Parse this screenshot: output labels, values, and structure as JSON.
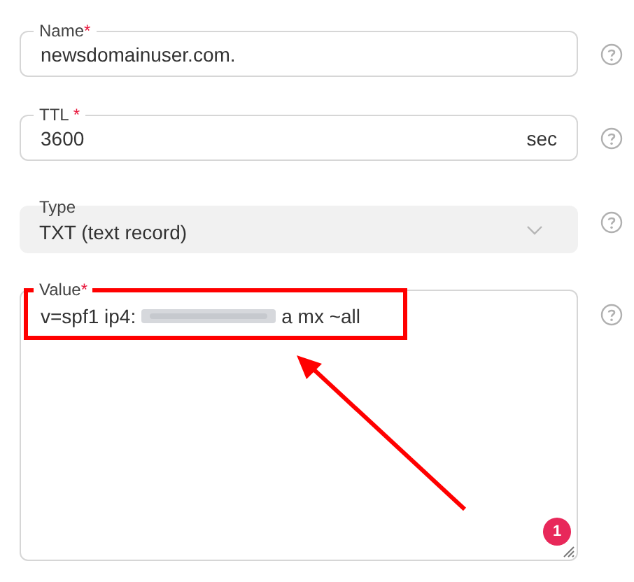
{
  "fields": [
    {
      "kind": "text",
      "label": "Name",
      "required_mark": "*",
      "value": "newsdomainuser.com."
    },
    {
      "kind": "suffix",
      "label": "TTL",
      "required_mark": "*",
      "value": "3600",
      "suffix": "sec"
    },
    {
      "kind": "select",
      "label": "Type",
      "value": "TXT (text record)"
    },
    {
      "kind": "textarea",
      "label": "Value",
      "required_mark": "*",
      "value_before": "v=spf1 ip4:",
      "value_after": "a mx ~all"
    }
  ],
  "badge": "1"
}
